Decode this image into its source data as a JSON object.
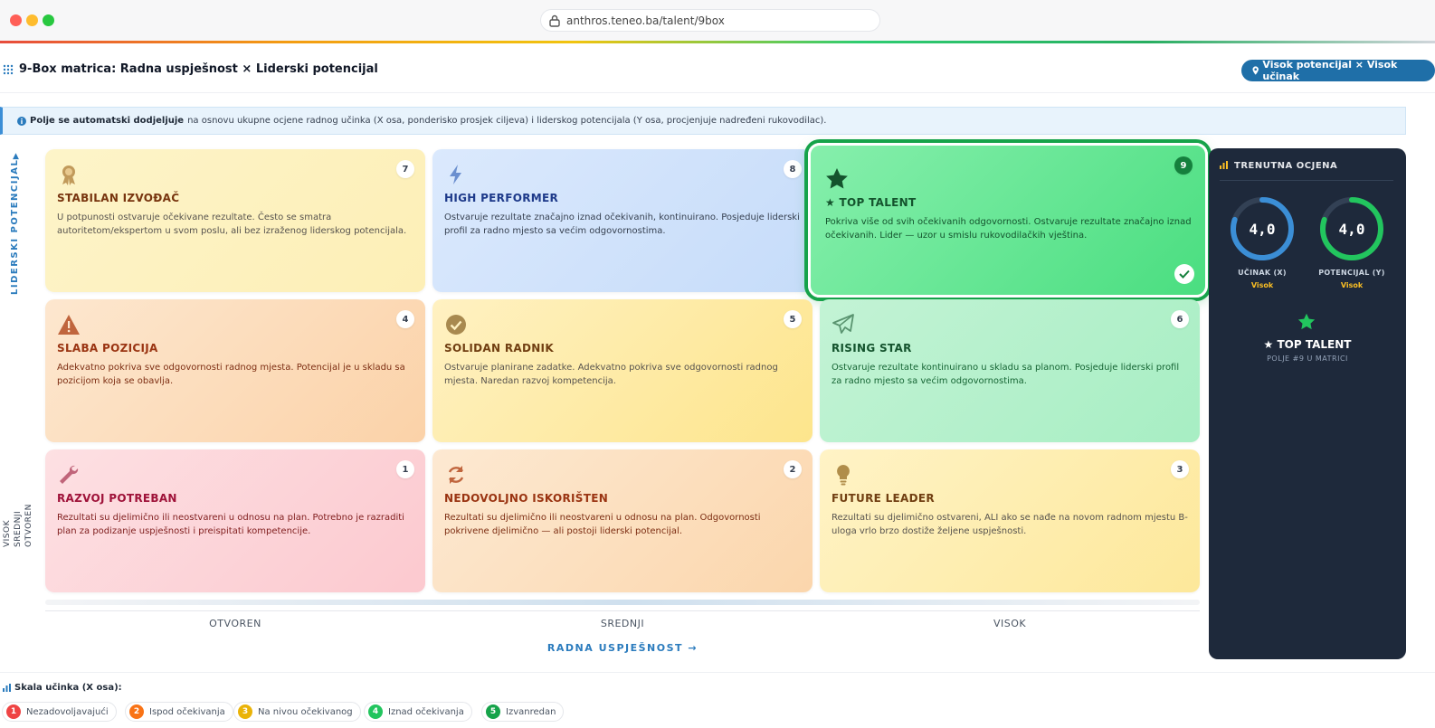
{
  "browser": {
    "url": "anthros.teneo.ba/talent/9box"
  },
  "header": {
    "title": "9-Box matrica: Radna uspješnost × Liderski potencijal",
    "badge": "Visok potencijal × Visok učinak"
  },
  "info": {
    "bold": "Polje se automatski dodjeljuje",
    "text": "na osnovu ukupne ocjene radnog učinka (X osa, ponderisko prosjek ciljeva) i liderskog potencijala (Y osa, procjenjuje nadređeni rukovodilac)."
  },
  "y_axis": {
    "label": "LIDERSKI POTENCIJAL",
    "levels": [
      "VISOK",
      "SREDNJI",
      "OTVOREN"
    ]
  },
  "x_axis": {
    "label": "RADNA USPJEŠNOST →",
    "levels": [
      "OTVOREN",
      "SREDNJI",
      "VISOK"
    ]
  },
  "boxes": {
    "b7": {
      "num": "7",
      "title": "STABILAN IZVOĐAČ",
      "desc": "U potpunosti ostvaruje očekivane rezultate. Često se smatra autoritetom/ekspertom u svom poslu, ali bez izraženog liderskog potencijala.",
      "icon": "award-icon"
    },
    "b8": {
      "num": "8",
      "title": "HIGH PERFORMER",
      "desc": "Ostvaruje rezultate značajno iznad očekivanih, kontinuirano. Posjeduje liderski profil za radno mjesto sa većim odgovornostima.",
      "icon": "bolt-icon"
    },
    "b9": {
      "num": "9",
      "title": "★ TOP TALENT",
      "desc": "Pokriva više od svih očekivanih odgovornosti. Ostvaruje rezultate značajno iznad očekivanih. Lider — uzor u smislu rukovodilačkih vještina.",
      "icon": "star-icon",
      "selected": true
    },
    "b4": {
      "num": "4",
      "title": "SLABA POZICIJA",
      "desc": "Adekvatno pokriva sve odgovornosti radnog mjesta. Potencijal je u skladu sa pozicijom koja se obavlja.",
      "icon": "warning-icon"
    },
    "b5": {
      "num": "5",
      "title": "SOLIDAN RADNIK",
      "desc": "Ostvaruje planirane zadatke. Adekvatno pokriva sve odgovornosti radnog mjesta. Naredan razvoj kompetencija.",
      "icon": "check-circle-icon"
    },
    "b6": {
      "num": "6",
      "title": "RISING STAR",
      "desc": "Ostvaruje rezultate kontinuirano u skladu sa planom. Posjeduje liderski profil za radno mjesto sa većim odgovornostima.",
      "icon": "paper-plane-icon"
    },
    "b1": {
      "num": "1",
      "title": "RAZVOJ POTREBAN",
      "desc": "Rezultati su djelimično ili neostvareni u odnosu na plan. Potrebno je razraditi plan za podizanje uspješnosti i preispitati kompetencije.",
      "icon": "wrench-icon"
    },
    "b2": {
      "num": "2",
      "title": "NEDOVOLJNO ISKORIŠTEN",
      "desc": "Rezultati su djelimično ili neostvareni u odnosu na plan. Odgovornosti pokrivene djelimično — ali postoji liderski potencijal.",
      "icon": "refresh-icon"
    },
    "b3": {
      "num": "3",
      "title": "FUTURE LEADER",
      "desc": "Rezultati su djelimično ostvareni, ALI ako se nađe na novom radnom mjestu B-uloga vrlo brzo dostiže željene uspješnosti.",
      "icon": "lightbulb-icon"
    }
  },
  "panel": {
    "title": "TRENUTNA OCJENA",
    "ucinak": {
      "value": "4,0",
      "label": "UČINAK (X)",
      "level": "Visok",
      "fill": 0.8
    },
    "potencijal": {
      "value": "4,0",
      "label": "POTENCIJAL (Y)",
      "level": "Visok",
      "fill": 0.8
    },
    "result_title": "★ TOP TALENT",
    "result_sub": "POLJE #9 U MATRICI"
  },
  "legend": {
    "title": "Skala učinka (X osa):",
    "items": [
      {
        "n": "1",
        "label": "Nezadovoljavajući",
        "color": "#ef4444"
      },
      {
        "n": "2",
        "label": "Ispod očekivanja",
        "color": "#f97316"
      },
      {
        "n": "3",
        "label": "Na nivou očekivanog",
        "color": "#eab308"
      },
      {
        "n": "4",
        "label": "Iznad očekivanja",
        "color": "#22c55e"
      },
      {
        "n": "5",
        "label": "Izvanredan",
        "color": "#16a34a"
      }
    ]
  }
}
